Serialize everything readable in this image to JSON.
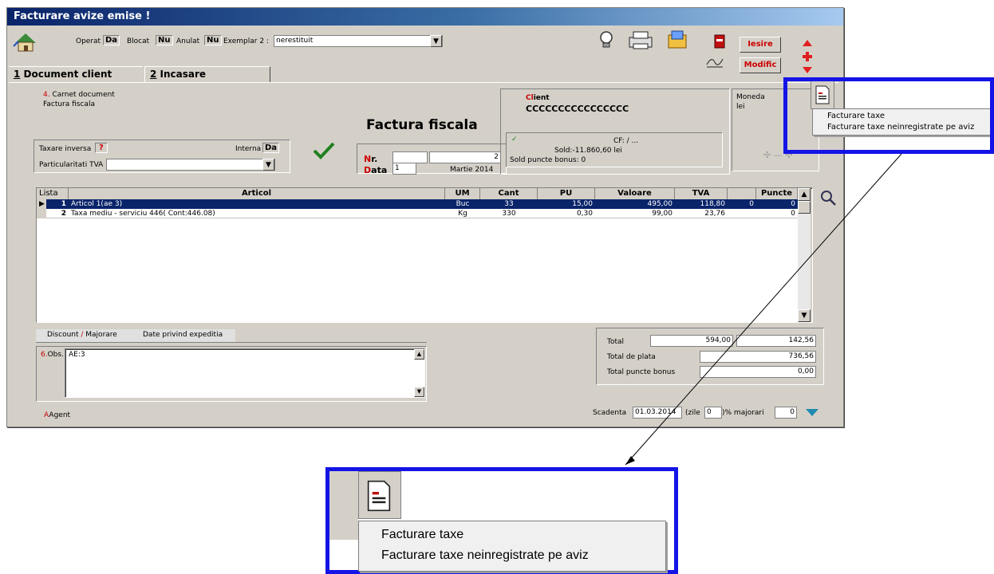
{
  "title": "Facturare avize emise !",
  "toolbar": {
    "operat_label": "Operat",
    "operat_value": "Da",
    "blocat_label": "Blocat",
    "blocat_value": "Nu",
    "anulat_label": "Anulat",
    "anulat_value": "Nu",
    "exemplar_label": "Exemplar 2 :",
    "exemplar_value": "nerestituit",
    "iesire_label": "Iesire",
    "modific_label": "Modific"
  },
  "tabs": [
    {
      "key": "1",
      "label": " Document client"
    },
    {
      "key": "2",
      "label": " Incasare"
    }
  ],
  "doc": {
    "carnet_num": "4.",
    "carnet_label": " Carnet document",
    "carnet_value": "Factura fiscala",
    "type_title": "Factura fiscala",
    "taxare_inversa_label": "Taxare inversa",
    "taxare_inversa_value": "?",
    "interna_label": "Interna",
    "interna_value": "Da",
    "particularitati_label": "Particularitati TVA",
    "particularitati_value": "",
    "nr_label_first": "N",
    "nr_label_rest": "r.",
    "nr_series": "",
    "nr_value": "2",
    "data_label_first": "D",
    "data_label_rest": "ata",
    "data_day": "1",
    "data_month": "Martie 2014"
  },
  "client": {
    "label_first": "Cl",
    "label_rest": "ient",
    "name": "CCCCCCCCCCCCCCCC",
    "check": "✓",
    "cf": "CF: / ...",
    "sold": "Sold:-11.860,60 lei",
    "sold_puncte": "Sold puncte bonus:  0"
  },
  "moneda": {
    "label": "Moneda",
    "value": "lei"
  },
  "menu": {
    "items": [
      "Facturare taxe",
      "Facturare taxe neinregistrate pe aviz"
    ]
  },
  "table": {
    "headers": [
      "Lista",
      "Articol",
      "UM",
      "Cant",
      "PU",
      "Valoare",
      "TVA",
      "",
      "Puncte"
    ],
    "rows": [
      {
        "nr": "1",
        "articol": "Articol 1(ae 3)",
        "um": "Buc",
        "cant": "33",
        "pu": "15,00",
        "valoare": "495,00",
        "tva": "118,80",
        "x": "0",
        "puncte": "0"
      },
      {
        "nr": "2",
        "articol": "Taxa mediu - serviciu 446( Cont:446.08)",
        "um": "Kg",
        "cant": "330",
        "pu": "0,30",
        "valoare": "99,00",
        "tva": "23,76",
        "x": "",
        "puncte": "0"
      }
    ]
  },
  "bottom_tabs": {
    "discount": "Discount",
    "slash": " / ",
    "majorare": "Majorare",
    "expeditia": "Date privind expeditia"
  },
  "obs": {
    "num": "6.",
    "label": "Obs.",
    "value": "AE:3"
  },
  "totals": {
    "total_label": "Total",
    "total_value": "594,00",
    "total_tva": "142,56",
    "plata_label": "Total de plata",
    "plata_value": "736,56",
    "puncte_label": "Total puncte bonus",
    "puncte_value": "0,00"
  },
  "footer": {
    "agent": "Agent",
    "scadenta_label": "Scadenta",
    "scadenta_value": "01.03.2014",
    "zile_label": "(zile",
    "zile_value": "0",
    "majorari_label": ")% majorari",
    "majorari_value": "0"
  },
  "zoom_menu": {
    "items": [
      "Facturare taxe",
      "Facturare taxe neinregistrate pe aviz"
    ]
  }
}
